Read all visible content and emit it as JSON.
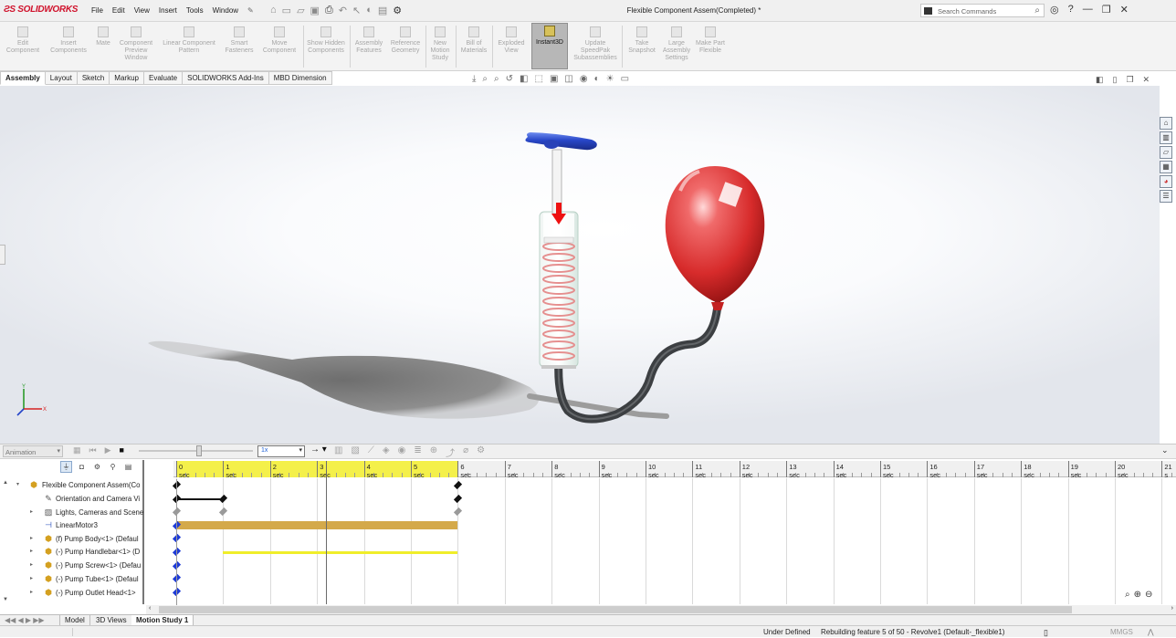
{
  "app": {
    "brand": "SOLIDWORKS",
    "doc_title": "Flexible Component Assem(Completed) *",
    "menus": [
      "File",
      "Edit",
      "View",
      "Insert",
      "Tools",
      "Window"
    ],
    "search_placeholder": "Search Commands"
  },
  "ribbon": {
    "buttons": [
      {
        "label": "Edit Component"
      },
      {
        "label": "Insert Components"
      },
      {
        "label": "Mate"
      },
      {
        "label": "Component Preview Window"
      },
      {
        "label": "Linear Component Pattern"
      },
      {
        "label": "Smart Fasteners"
      },
      {
        "label": "Move Component"
      },
      {
        "label": "Show Hidden Components"
      },
      {
        "label": "Assembly Features"
      },
      {
        "label": "Reference Geometry"
      },
      {
        "label": "New Motion Study"
      },
      {
        "label": "Bill of Materials"
      },
      {
        "label": "Exploded View"
      },
      {
        "label": "Instant3D"
      },
      {
        "label": "Update SpeedPak Subassemblies"
      },
      {
        "label": "Take Snapshot"
      },
      {
        "label": "Large Assembly Settings"
      },
      {
        "label": "Make Part Flexible"
      }
    ]
  },
  "command_tabs": [
    "Assembly",
    "Layout",
    "Sketch",
    "Markup",
    "Evaluate",
    "SOLIDWORKS Add-Ins",
    "MBD Dimension"
  ],
  "motion": {
    "study_type": "Animation",
    "speed": "1x"
  },
  "tree": {
    "items": [
      {
        "label": "Flexible Component Assem(Co",
        "icon": "assembly-icon",
        "expandable": true
      },
      {
        "label": "Orientation and Camera Vi",
        "icon": "camera-view-icon",
        "expandable": false
      },
      {
        "label": "Lights, Cameras and Scene",
        "icon": "lights-icon",
        "expandable": true
      },
      {
        "label": "LinearMotor3",
        "icon": "linear-motor-icon",
        "expandable": false
      },
      {
        "label": "(f) Pump Body<1> (Defaul",
        "icon": "part-icon",
        "expandable": true
      },
      {
        "label": "(-) Pump Handlebar<1> (D",
        "icon": "part-icon",
        "expandable": true
      },
      {
        "label": "(-) Pump Screw<1> (Defau",
        "icon": "part-icon",
        "expandable": true
      },
      {
        "label": "(-) Pump Tube<1> (Defaul",
        "icon": "part-icon",
        "expandable": true
      },
      {
        "label": "(-) Pump Outlet Head<1>",
        "icon": "part-icon",
        "expandable": true
      }
    ]
  },
  "timeline": {
    "ticks": [
      "0 sec",
      "1 sec",
      "2 sec",
      "3 sec",
      "4 sec",
      "5 sec",
      "6 sec",
      "7 sec",
      "8 sec",
      "9 sec",
      "10 sec",
      "11 sec",
      "12 sec",
      "13 sec",
      "14 sec",
      "15 sec",
      "16 sec",
      "17 sec",
      "18 sec",
      "19 sec",
      "20 sec",
      "21 s"
    ],
    "duration_sec": 6,
    "current_time_sec": 3.2
  },
  "bottom_tabs": [
    "Model",
    "3D Views",
    "Motion Study 1"
  ],
  "status": {
    "state": "Under Defined",
    "message": "Rebuilding feature 5 of 50 - Revolve1 (Default-_flexible1)",
    "units": "MMGS"
  },
  "colors": {
    "timeline_highlight": "#f4f04a",
    "motor_bar": "#d4a94a",
    "change_bar": "#f0ee2a",
    "keyframe": "#1e3bd6"
  }
}
